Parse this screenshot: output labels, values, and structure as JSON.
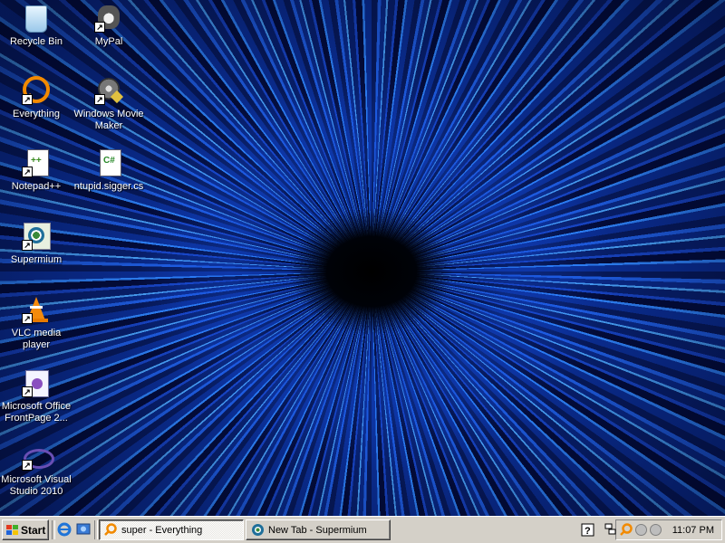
{
  "desktop": {
    "icons": [
      {
        "label": "Recycle Bin",
        "icon": "recycle-bin-icon"
      },
      {
        "label": "MyPal",
        "icon": "mypal-icon"
      },
      {
        "label": "Everything",
        "icon": "everything-search-icon"
      },
      {
        "label": "Windows Movie Maker",
        "icon": "movie-maker-icon"
      },
      {
        "label": "Notepad++",
        "icon": "notepad-plus-plus-icon"
      },
      {
        "label": "ntupid.sigger.cs",
        "icon": "csharp-file-icon"
      },
      {
        "label": "Supermium",
        "icon": "supermium-icon"
      },
      {
        "label": "VLC media player",
        "icon": "vlc-cone-icon"
      },
      {
        "label": "Microsoft Office FrontPage 2...",
        "icon": "frontpage-icon"
      },
      {
        "label": "Microsoft Visual Studio 2010",
        "icon": "visual-studio-icon"
      }
    ]
  },
  "taskbar": {
    "start_label": "Start",
    "quick_launch": [
      "internet-explorer-icon",
      "show-desktop-icon"
    ],
    "tasks": [
      {
        "label": "super - Everything",
        "icon": "everything-search-icon",
        "active": true
      },
      {
        "label": "New Tab - Supermium",
        "icon": "supermium-icon",
        "active": false
      }
    ],
    "tray": {
      "icons": [
        "help-icon",
        "network-icon",
        "everything-search-icon",
        "tray-circle-icon",
        "tray-circle-icon"
      ],
      "clock": "11:07 PM"
    }
  },
  "colors": {
    "taskbar_bg": "#d4d0c8",
    "wallpaper_accent": "#1f5fe6"
  }
}
